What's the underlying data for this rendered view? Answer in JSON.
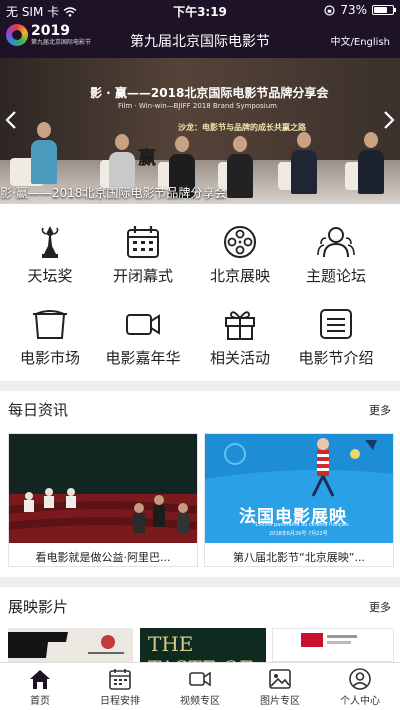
{
  "status_bar": {
    "carrier": "无 SIM 卡",
    "time": "下午3:19",
    "battery": "73%",
    "battery_level": 0.73
  },
  "header": {
    "logo_year": "2019",
    "logo_sub": "第九届北京国际电影节",
    "title": "第九届北京国际电影节",
    "language": "中文/English"
  },
  "banner": {
    "title": "影 · 赢——2018北京国际电影节品牌分享会",
    "subtitle_en": "Film · Win-win—BJIFF 2018 Brand Symposium",
    "speaker_line": "沙龙：电影节与品牌的成长共赢之路",
    "brush_text": "赢",
    "caption": "影·赢——2018北京国际电影节品牌分享会",
    "prev_icon": "chevron-left-icon",
    "next_icon": "chevron-right-icon"
  },
  "menu": [
    {
      "label": "天坛奖",
      "icon": "trophy-icon"
    },
    {
      "label": "开闭幕式",
      "icon": "calendar-icon"
    },
    {
      "label": "北京展映",
      "icon": "film-reel-icon"
    },
    {
      "label": "主题论坛",
      "icon": "people-icon"
    },
    {
      "label": "电影市场",
      "icon": "screen-icon"
    },
    {
      "label": "电影嘉年华",
      "icon": "camera-icon"
    },
    {
      "label": "相关活动",
      "icon": "gift-icon"
    },
    {
      "label": "电影节介绍",
      "icon": "document-icon"
    }
  ],
  "news": {
    "title": "每日资讯",
    "more": "更多",
    "items": [
      {
        "caption": "看电影就是做公益·阿里巴..."
      },
      {
        "caption": "第八届北影节“北京展映”..."
      }
    ],
    "poster": {
      "cn": "法国电影展映",
      "fr": "15ème panorama du cinéma français",
      "date": "2018年6月26号-7月22号"
    }
  },
  "films": {
    "title": "展映影片",
    "more": "更多",
    "items": [
      {
        "text": ""
      },
      {
        "text": "THE TASTE OF"
      },
      {
        "text": ""
      }
    ]
  },
  "tabbar": [
    {
      "label": "首页",
      "icon": "home-icon",
      "active": true
    },
    {
      "label": "日程安排",
      "icon": "schedule-icon",
      "active": false
    },
    {
      "label": "视频专区",
      "icon": "video-icon",
      "active": false
    },
    {
      "label": "图片专区",
      "icon": "image-icon",
      "active": false
    },
    {
      "label": "个人中心",
      "icon": "user-icon",
      "active": false
    }
  ],
  "colors": {
    "header_bg": "#1e1226",
    "poster_blue": "#2aa1e6",
    "text": "#222222"
  }
}
